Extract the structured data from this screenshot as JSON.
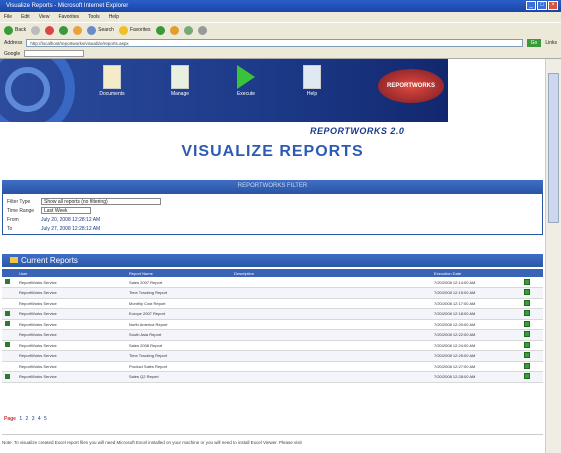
{
  "window": {
    "title": "Visualize Reports - Microsoft Internet Explorer"
  },
  "menu": [
    "File",
    "Edit",
    "View",
    "Favorites",
    "Tools",
    "Help"
  ],
  "toolbar": {
    "back_label": "Back",
    "search_label": "Search",
    "favorites_label": "Favorites"
  },
  "address": {
    "label": "Address",
    "url": "http://localhost/reportworks/visualize/reports.aspx",
    "go_label": "Go",
    "links_label": "Links",
    "google_label": "Google"
  },
  "nav": {
    "items": [
      {
        "label": "Documents"
      },
      {
        "label": "Manage"
      },
      {
        "label": "Execute"
      },
      {
        "label": "Help"
      }
    ]
  },
  "brand": {
    "logo_text": "REPORTWORKS",
    "tagline": "REPORTWORKS 2.0"
  },
  "page_title": "VISUALIZE REPORTS",
  "filter": {
    "header": "REPORTWORKS FILTER",
    "rows": [
      {
        "label": "Filter Type",
        "value": "Show all reports (no filtering)"
      },
      {
        "label": "Time Range",
        "value": "Last Week"
      },
      {
        "label": "From",
        "value": "July 20, 2008 12:28:12 AM"
      },
      {
        "label": "To",
        "value": "July 27, 2008 12:28:12 AM"
      }
    ]
  },
  "section": {
    "title": "Current Reports"
  },
  "table": {
    "columns": [
      "",
      "User",
      "Report Name",
      "Description",
      "Execution Date",
      ""
    ],
    "rows": [
      {
        "user": "ReportWorks Service",
        "report": "Sales 2007 Report",
        "desc": "",
        "date": "7/20/2008 12:14:00 AM"
      },
      {
        "user": "ReportWorks Service",
        "report": "Time Tracking Report",
        "desc": "",
        "date": "7/20/2008 12:15:00 AM"
      },
      {
        "user": "ReportWorks Service",
        "report": "Monthly Cost Report",
        "desc": "",
        "date": "7/20/2008 12:17:00 AM"
      },
      {
        "user": "ReportWorks Service",
        "report": "Europe 2007 Report",
        "desc": "",
        "date": "7/20/2008 12:18:00 AM"
      },
      {
        "user": "ReportWorks Service",
        "report": "North America Report",
        "desc": "",
        "date": "7/20/2008 12:20:00 AM"
      },
      {
        "user": "ReportWorks Service",
        "report": "South Asia Report",
        "desc": "",
        "date": "7/20/2008 12:22:00 AM"
      },
      {
        "user": "ReportWorks Service",
        "report": "Sales 2008 Report",
        "desc": "",
        "date": "7/20/2008 12:24:00 AM"
      },
      {
        "user": "ReportWorks Service",
        "report": "Time Tracking Report",
        "desc": "",
        "date": "7/20/2008 12:25:00 AM"
      },
      {
        "user": "ReportWorks Service",
        "report": "Product Sales Report",
        "desc": "",
        "date": "7/20/2008 12:27:00 AM"
      },
      {
        "user": "ReportWorks Service",
        "report": "Sales Q2 Report",
        "desc": "",
        "date": "7/20/2008 12:28:00 AM"
      }
    ]
  },
  "pager": {
    "label": "Page",
    "pages": [
      "1",
      "2",
      "3",
      "4",
      "5"
    ]
  },
  "note": "Note: To visualize created Excel report files you will need Microsoft Excel installed on your machine or you will need to install Excel Viewer. Please visit"
}
